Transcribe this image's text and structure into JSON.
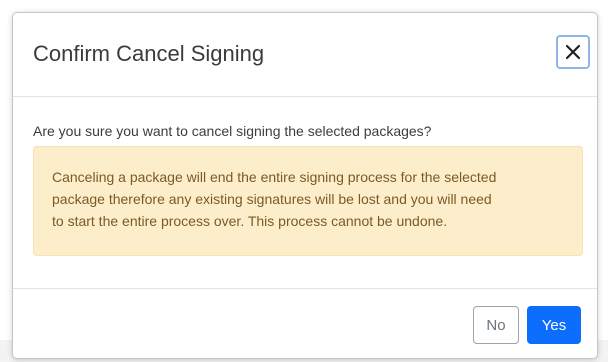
{
  "dialog": {
    "title": "Confirm Cancel Signing",
    "close_icon": "close-icon",
    "question": "Are you sure you want to cancel signing the selected packages?",
    "warning_lines": [
      "Canceling a package will end the entire signing process for the selected",
      "package therefore any existing signatures will be lost and you will need",
      "to start the entire process over. This process cannot be undone."
    ],
    "buttons": {
      "no_label": "No",
      "yes_label": "Yes"
    }
  },
  "colors": {
    "primary": "#0d6efd",
    "warning_bg": "#fdeecb",
    "warning_text": "#7b5a24",
    "title_text": "#3b3b3b"
  }
}
